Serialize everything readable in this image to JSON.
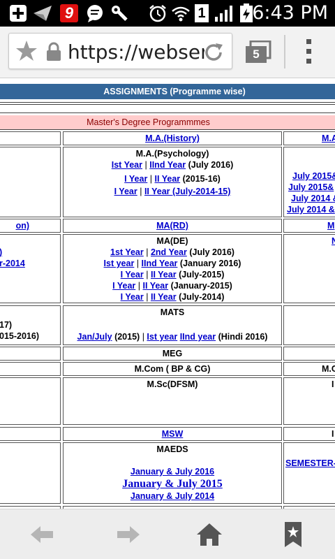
{
  "status_bar": {
    "time": "6:43 PM",
    "notification_badge": "9",
    "sim_label": "1",
    "icons": [
      "add-icon",
      "send-icon",
      "app-9-icon",
      "chat-icon",
      "wrench-icon",
      "alarm-icon",
      "wifi-icon",
      "sim-icon",
      "signal-icon",
      "battery-icon"
    ]
  },
  "browser": {
    "url": "https://webserv",
    "tab_count": "5"
  },
  "page": {
    "section_title": "ASSIGNMENTS (Programme wise)",
    "subsection_title": "Master's Degree Programmmes",
    "row1": {
      "center_head": "M.A.(History)",
      "right_head": "M.A"
    },
    "row2": {
      "title": "M.A.(Psychology)",
      "line1": {
        "a": "Ist Year",
        "sep": "|",
        "b": "IInd Year",
        "tail": "(July 2016)"
      },
      "line2": {
        "a": "I Year",
        "sep": "|",
        "b": "II Year",
        "tail": "(2015-16)"
      },
      "line3": {
        "a": "I Year",
        "sep": "|",
        "b": "II Year (July-2014-15)"
      },
      "right_lines": [
        "July 2015&",
        "July 2015&",
        "July 2014 &",
        "July 2014 &"
      ]
    },
    "row3": {
      "left_head": "on)",
      "center_head": "MA(RD)",
      "right_head": "M"
    },
    "row4": {
      "title": "MA(DE)",
      "line1": {
        "a": "1st Year",
        "sep": "|",
        "b": "2nd Year",
        "tail": "(July 2016)"
      },
      "line2": {
        "a": "Ist year",
        "sep": "|",
        "b": "IInd Year",
        "tail": "(January 2016)"
      },
      "line3": {
        "a": "I Year",
        "sep": "|",
        "b": "II Year",
        "tail": "(July-2015)"
      },
      "line4": {
        "a": "I Year",
        "sep": "|",
        "b": "II Year",
        "tail": "(January-2015)"
      },
      "line5": {
        "a": "I Year",
        "sep": "|",
        "b": "II Year",
        "tail": "(July-2014)"
      },
      "left_lines": [
        ")",
        "r-2014"
      ],
      "right_lines": [
        "N"
      ]
    },
    "row5": {
      "title": "MATS",
      "a": "Jan/July",
      "a_tail": "(2015)",
      "sep": "|",
      "b": "Ist year",
      "c": "IInd year",
      "c_tail": "(Hindi 2016)",
      "left_lines": [
        "17)",
        "015-2016)"
      ]
    },
    "row6": {
      "center_head": "MEG"
    },
    "row7": {
      "center_head": "M.Com ( BP & CG)",
      "right_head": "M.C"
    },
    "row8": {
      "center_head": "M.Sc(DFSM)",
      "right_head": "I"
    },
    "row9": {
      "center_head": "MSW",
      "right_head": "I"
    },
    "row10": {
      "title": "MAEDS",
      "line1": "January & July 2016",
      "line2": "January & July 2015",
      "line3": "January & July 2014",
      "right_lines": [
        "SEMESTER-"
      ]
    }
  },
  "bottom_nav": {
    "icons": [
      "back-arrow-icon",
      "forward-arrow-icon",
      "home-icon",
      "bookmark-icon"
    ]
  },
  "colors": {
    "header_blue": "#336699",
    "header_pink": "#ffcccc",
    "link_blue": "#0000cc"
  }
}
